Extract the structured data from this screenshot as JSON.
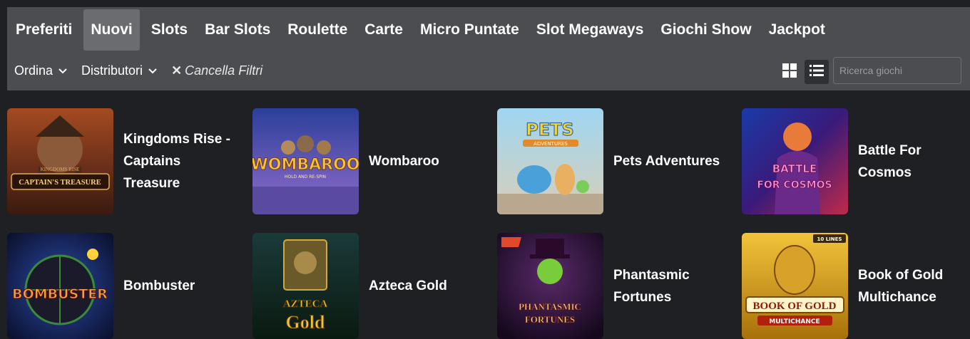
{
  "categories": [
    {
      "label": "Preferiti",
      "active": false
    },
    {
      "label": "Nuovi",
      "active": true
    },
    {
      "label": "Slots",
      "active": false
    },
    {
      "label": "Bar Slots",
      "active": false
    },
    {
      "label": "Roulette",
      "active": false
    },
    {
      "label": "Carte",
      "active": false
    },
    {
      "label": "Micro Puntate",
      "active": false
    },
    {
      "label": "Slot Megaways",
      "active": false
    },
    {
      "label": "Giochi Show",
      "active": false
    },
    {
      "label": "Jackpot",
      "active": false
    }
  ],
  "filters": {
    "sort_label": "Ordina",
    "providers_label": "Distributori",
    "clear_label": "Cancella Filtri"
  },
  "view": {
    "mode": "list",
    "grid_icon": "grid-icon",
    "list_icon": "list-icon"
  },
  "search": {
    "placeholder": "Ricerca giochi",
    "value": ""
  },
  "games": [
    {
      "name": "Kingdoms Rise - Captains Treasure",
      "thumb_text": "CAPTAIN'S TREASURE",
      "thumb_small": "KINGDOMS RISE",
      "colors": [
        "#6b2d1a",
        "#c8792f"
      ]
    },
    {
      "name": "Wombaroo",
      "thumb_text": "WOMBAROO",
      "thumb_small": "HOLD AND RE-SPIN",
      "colors": [
        "#3b4f9e",
        "#8d6fc7"
      ]
    },
    {
      "name": "Pets Adventures",
      "thumb_text": "PETS",
      "thumb_small": "ADVENTURES",
      "colors": [
        "#7fc4e8",
        "#d9c9a3"
      ]
    },
    {
      "name": "Battle For Cosmos",
      "thumb_text": "BATTLE FOR COSMOS",
      "thumb_small": "",
      "colors": [
        "#1a2a8a",
        "#d63aa6"
      ]
    },
    {
      "name": "Bombuster",
      "thumb_text": "BOMBUSTER",
      "thumb_small": "",
      "colors": [
        "#0a1a4a",
        "#c23a2a"
      ]
    },
    {
      "name": "Azteca Gold",
      "thumb_text": "AZTECA GOLD",
      "thumb_small": "",
      "colors": [
        "#0f2a2a",
        "#b58a2a"
      ]
    },
    {
      "name": "Phantasmic Fortunes",
      "thumb_text": "PHANTASMIC FORTUNES",
      "thumb_small": "",
      "colors": [
        "#2a0f3a",
        "#7a2a6a"
      ]
    },
    {
      "name": "Book of Gold Multichance",
      "thumb_text": "BOOK OF GOLD",
      "thumb_small": "MULTICHANCE",
      "badge": "10 LINES",
      "colors": [
        "#8a5a0a",
        "#f2c43a"
      ]
    }
  ]
}
